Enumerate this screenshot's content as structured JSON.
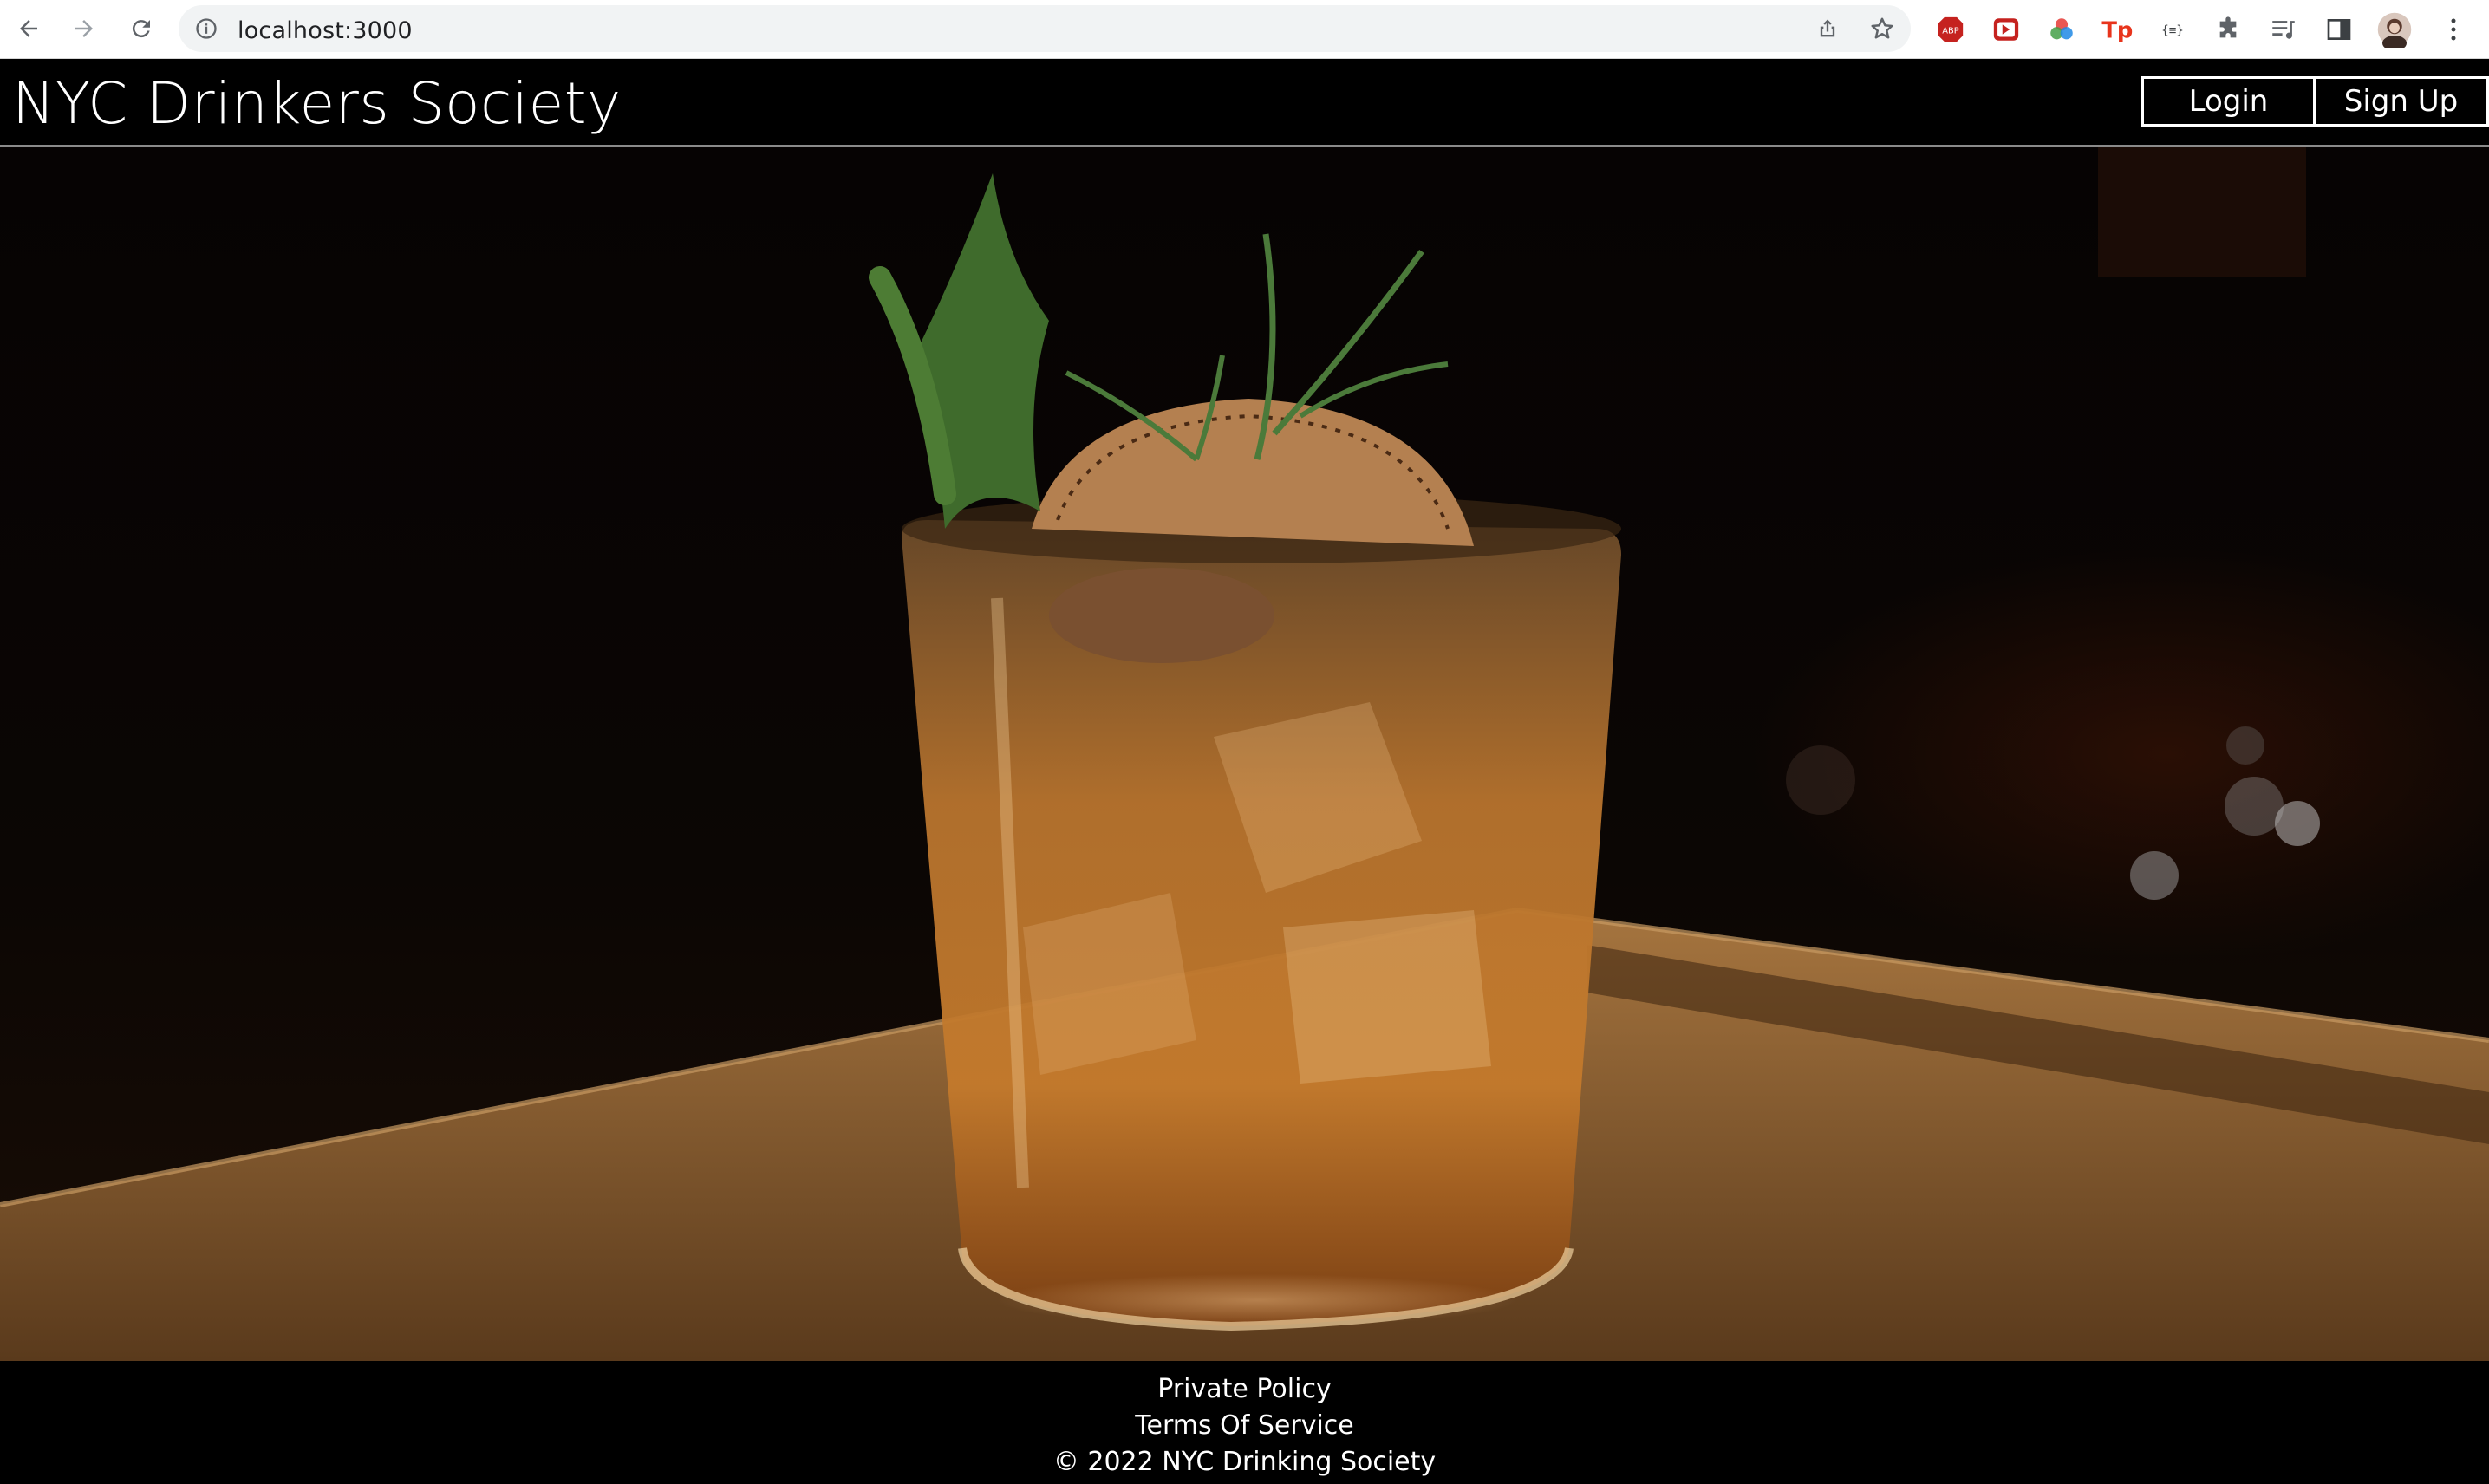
{
  "browser": {
    "url": "localhost:3000",
    "icons": {
      "back": "back-arrow-icon",
      "forward": "forward-arrow-icon",
      "reload": "reload-icon",
      "info": "info-icon",
      "share": "share-icon",
      "bookmark": "star-icon",
      "menu": "kebab-menu-icon"
    }
  },
  "header": {
    "title": "NYC Drinkers Society",
    "login_label": "Login",
    "signup_label": "Sign Up"
  },
  "hero": {
    "image": "cocktail-glass-on-wooden-tray",
    "colors": {
      "background": "#070403",
      "amber": "#c97a2a",
      "wood": "#8a5a2c"
    }
  },
  "footer": {
    "privacy_label": "Private Policy",
    "terms_label": "Terms Of Service",
    "copyright": "© 2022 NYC Drinking Society"
  }
}
